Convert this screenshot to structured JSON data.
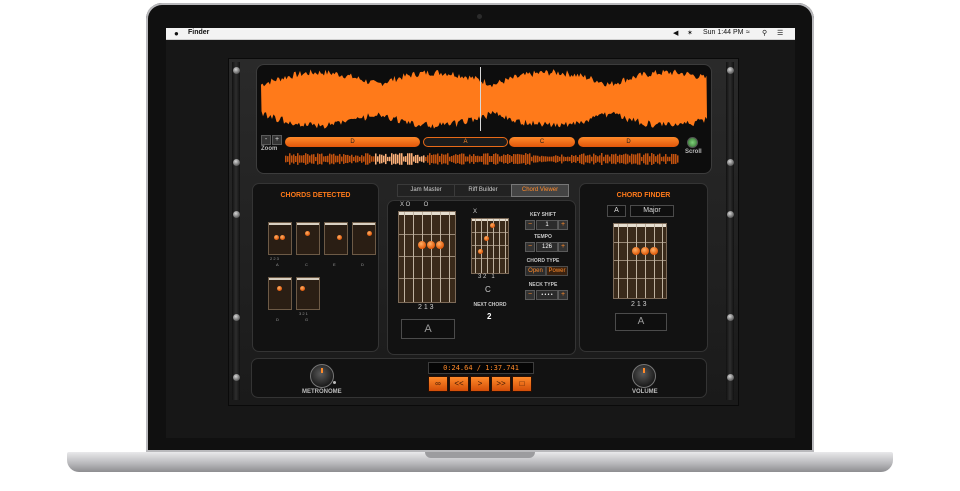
{
  "menubar": {
    "apple": "",
    "app": "Finder",
    "clock": "Sun 1:44 PM",
    "icons": [
      "volume-icon",
      "bluetooth-icon",
      "wifi-icon",
      "search-icon",
      "menu-icon"
    ]
  },
  "waveform": {
    "zoom_label": "Zoom",
    "scroll_label": "Scroll",
    "zoom_minus": "-",
    "zoom_plus": "+",
    "segments": [
      {
        "label": "D",
        "active": false
      },
      {
        "label": "A",
        "active": true
      },
      {
        "label": "C",
        "active": false
      },
      {
        "label": "D",
        "active": false
      }
    ],
    "accent": "#ff7a1a"
  },
  "chords_detected": {
    "title": "CHORDS DETECTED",
    "chords": [
      "A",
      "C",
      "E",
      "D",
      "D",
      "G"
    ],
    "frets": [
      "2 2 3",
      "",
      "",
      "",
      "",
      "3 2 1"
    ]
  },
  "tabs": {
    "items": [
      "Jam Master",
      "Riff Builder",
      "Chord Viewer"
    ],
    "active": "Chord Viewer"
  },
  "chord_viewer": {
    "open_marks": "X O        O",
    "big_fingers": "2 1 3",
    "big_name": "A",
    "small_marks": "X",
    "small_fingers": "3 2   1",
    "small_name": "C",
    "next_chord_label": "NEXT CHORD",
    "next_chord_value": "2",
    "key_shift_label": "KEY SHIFT",
    "key_shift_value": "1",
    "tempo_label": "TEMPO",
    "tempo_value": "126",
    "chord_type_label": "CHORD TYPE",
    "chord_type_options": [
      "Open",
      "Power"
    ],
    "neck_type_label": "NECK TYPE",
    "neck_type_value": "• • • •",
    "minus": "−",
    "plus": "+"
  },
  "chord_finder": {
    "title": "CHORD FINDER",
    "root": "A",
    "quality": "Major",
    "fingers": "2 1 3",
    "name": "A"
  },
  "transport": {
    "time": "0:24.64 / 1:37.741",
    "metronome_label": "METRONOME",
    "volume_label": "VOLUME",
    "buttons": [
      "∞",
      "<<",
      ">",
      ">>",
      "□"
    ]
  }
}
